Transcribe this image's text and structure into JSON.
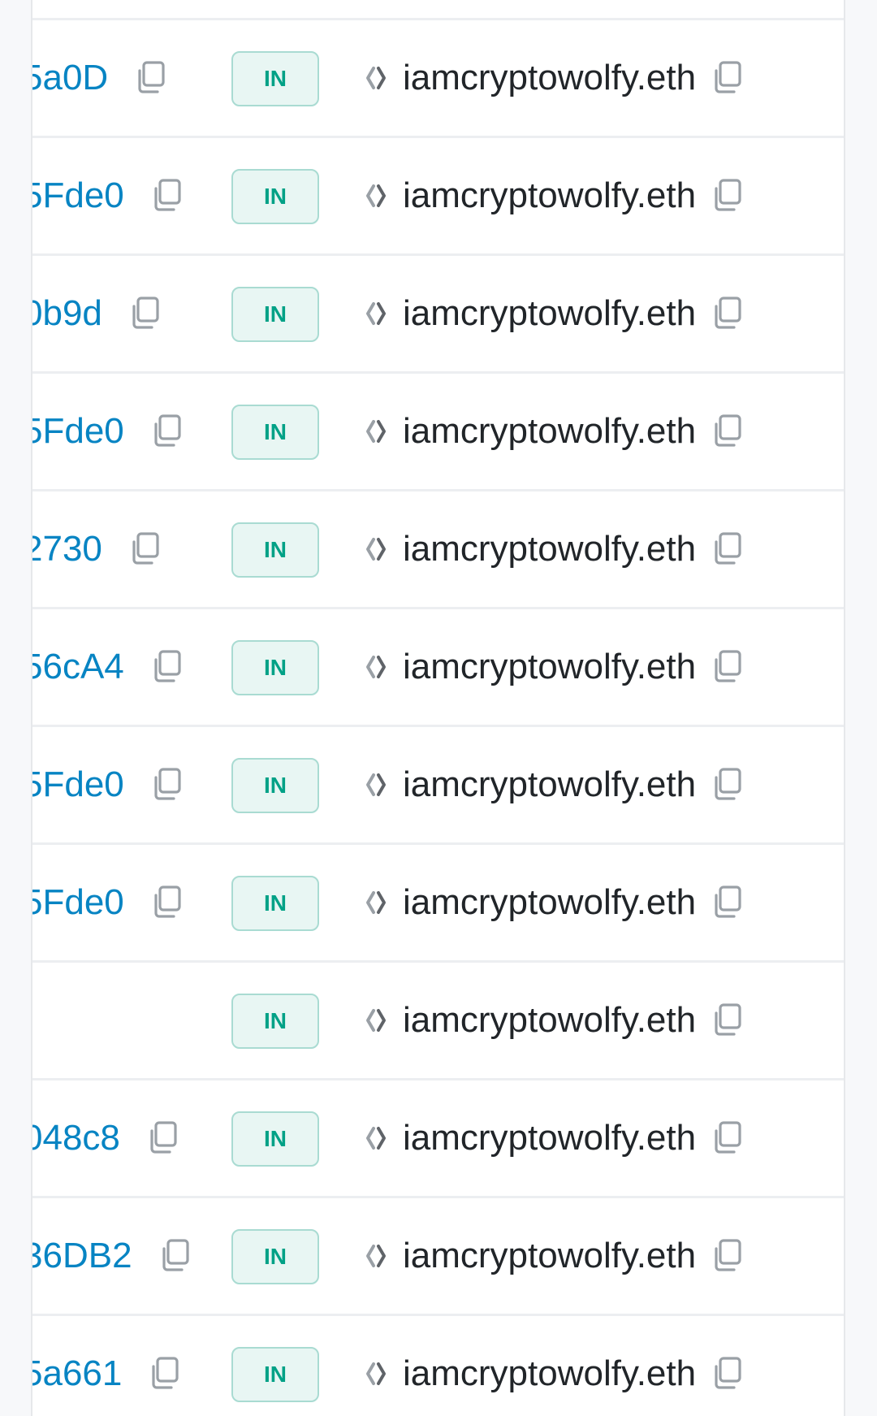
{
  "colors": {
    "hash_link": "#0784c3",
    "badge_text": "#00a186",
    "badge_bg": "#e8f6f3",
    "badge_border": "#a9dbd2",
    "icon_gray": "#9aa0a6",
    "text": "#212529"
  },
  "rows": [
    {
      "hash": "…a0D",
      "hash_partial": "5a0D",
      "direction": "IN",
      "to": "iamcryptowolfy.eth"
    },
    {
      "hash_partial": "5Fde0",
      "direction": "IN",
      "to": "iamcryptowolfy.eth"
    },
    {
      "hash_partial": "0b9d",
      "direction": "IN",
      "to": "iamcryptowolfy.eth"
    },
    {
      "hash_partial": "5Fde0",
      "direction": "IN",
      "to": "iamcryptowolfy.eth"
    },
    {
      "hash_partial": "2730",
      "direction": "IN",
      "to": "iamcryptowolfy.eth"
    },
    {
      "hash_partial": "56cA4",
      "direction": "IN",
      "to": "iamcryptowolfy.eth"
    },
    {
      "hash_partial": "5Fde0",
      "direction": "IN",
      "to": "iamcryptowolfy.eth"
    },
    {
      "hash_partial": "5Fde0",
      "direction": "IN",
      "to": "iamcryptowolfy.eth"
    },
    {
      "hash_partial": "",
      "direction": "IN",
      "to": "iamcryptowolfy.eth"
    },
    {
      "hash_partial": "048c8",
      "direction": "IN",
      "to": "iamcryptowolfy.eth"
    },
    {
      "hash_partial": "36DB2",
      "direction": "IN",
      "to": "iamcryptowolfy.eth"
    },
    {
      "hash_partial": "5a661",
      "direction": "IN",
      "to": "iamcryptowolfy.eth"
    }
  ],
  "icons": {
    "copy": "copy-icon",
    "contract": "contract-icon"
  }
}
